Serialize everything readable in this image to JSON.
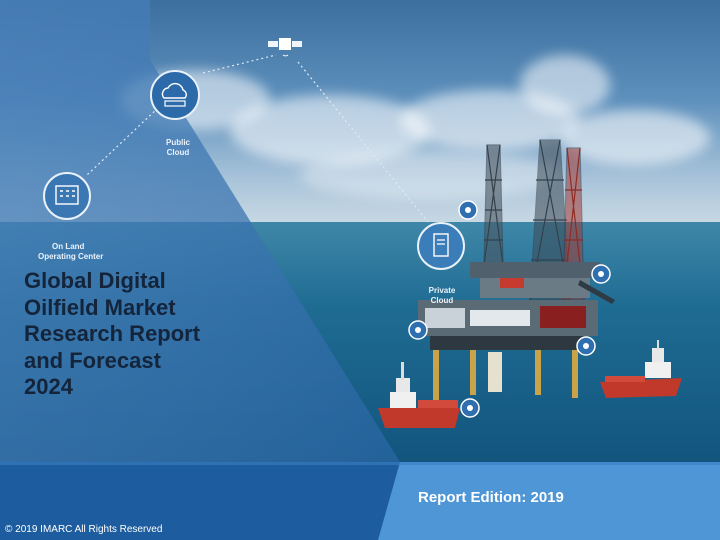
{
  "title_lines": [
    "Global Digital",
    "Oilfield Market",
    "Research Report",
    "and Forecast",
    "2024"
  ],
  "nodes": {
    "public_cloud": [
      "Public",
      "Cloud"
    ],
    "on_land": [
      "On Land",
      "Operating Center"
    ],
    "private_cloud": [
      "Private",
      "Cloud"
    ]
  },
  "report_edition": "Report Edition: 2019",
  "copyright": "© 2019 IMARC All Rights Reserved",
  "colors": {
    "panel": "#2f6fb0",
    "band_dark": "#1d5d9f",
    "band_light": "#4e96d6",
    "title": "#14243b"
  },
  "icons": [
    "satellite-icon",
    "public-cloud-icon",
    "building-icon",
    "server-icon",
    "target-icon"
  ]
}
